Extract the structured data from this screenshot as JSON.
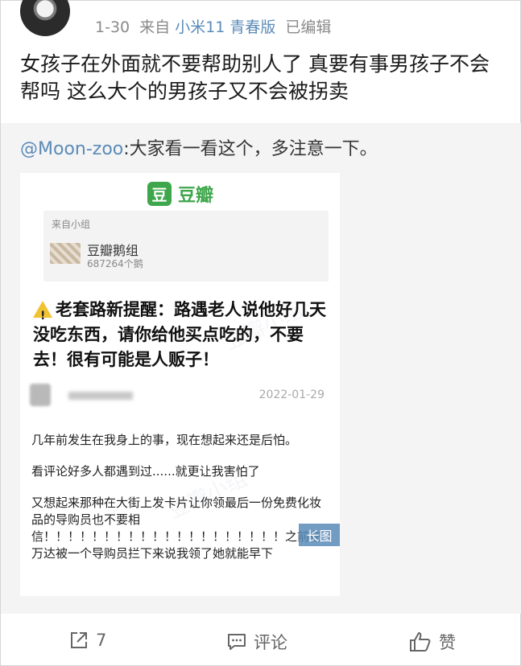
{
  "header": {
    "date": "1-30",
    "source_prefix": "来自",
    "device": "小米11 青春版",
    "edited": "已编辑"
  },
  "post": {
    "text": "女孩子在外面就不要帮助别人了 真要有事男孩子不会帮吗 这么大个的男孩子又不会被拐卖"
  },
  "repost": {
    "mention": "@Moon-zoo",
    "text": ":大家看一看这个，多注意一下。"
  },
  "card": {
    "logo_char": "豆",
    "logo_text": "豆瓣",
    "group_from": "来自小组",
    "group_name": "豆瓣鹅组",
    "group_count": "687264个鹅",
    "headline": "老套路新提醒：路遇老人说他好几天没吃东西，请你给他买点吃的，不要去！很有可能是人贩子！",
    "date": "2022-01-29",
    "paragraphs": [
      "几年前发生在我身上的事，现在想起来还是后怕。",
      "看评论好多人都遇到过......就更让我害怕了",
      "又想起来那种在大街上发卡片让你领最后一份免费化妆品的导购员也不要相信！！！！！！！！！！！！！！！！！！！！之前在万达被一个导购员拦下来说我领了她就能早下"
    ],
    "long_image_badge": "长图"
  },
  "actions": {
    "share_count": "7",
    "comment_label": "评论",
    "like_label": "赞"
  },
  "colors": {
    "link": "#5b8bb8",
    "douban_green": "#3ea64b",
    "repost_bg": "#f4f4f4"
  }
}
